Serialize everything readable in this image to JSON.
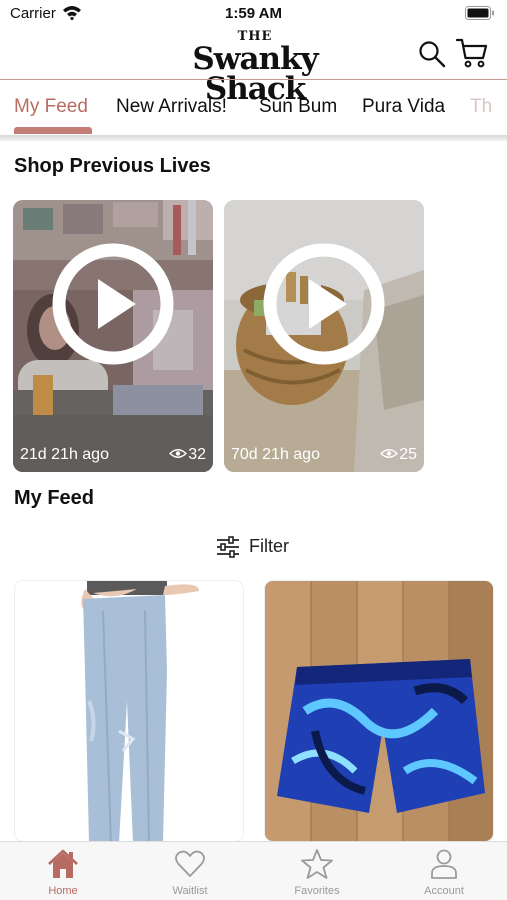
{
  "status_bar": {
    "carrier": "Carrier",
    "time": "1:59 AM"
  },
  "header": {
    "logo_the": "THE",
    "logo_name": "Swanky Shack"
  },
  "tabs": [
    {
      "label": "My Feed",
      "active": true
    },
    {
      "label": "New Arrivals!"
    },
    {
      "label": "Sun Bum"
    },
    {
      "label": "Pura Vida"
    },
    {
      "label": "Th"
    }
  ],
  "previous_lives": {
    "title": "Shop Previous Lives",
    "cards": [
      {
        "ago": "21d 21h ago",
        "views": "32"
      },
      {
        "ago": "70d 21h ago",
        "views": "25"
      }
    ]
  },
  "feed": {
    "title": "My Feed",
    "filter_label": "Filter"
  },
  "bottom_nav": [
    {
      "label": "Home",
      "icon": "home-icon",
      "active": true
    },
    {
      "label": "Waitlist",
      "icon": "heart-icon"
    },
    {
      "label": "Favorites",
      "icon": "star-icon"
    },
    {
      "label": "Account",
      "icon": "person-icon"
    }
  ],
  "colors": {
    "accent": "#b86b62",
    "divider": "#c49a92"
  }
}
